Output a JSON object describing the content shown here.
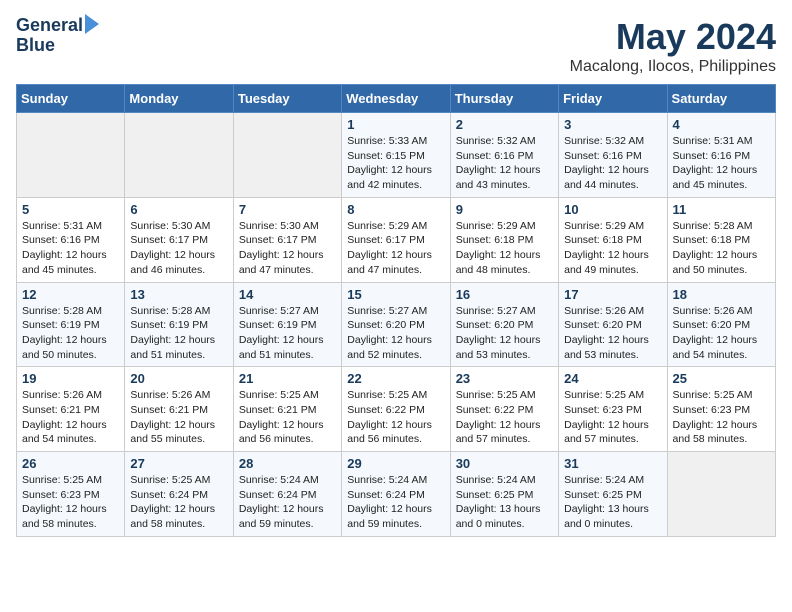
{
  "logo": {
    "line1": "General",
    "line2": "Blue"
  },
  "title": "May 2024",
  "location": "Macalong, Ilocos, Philippines",
  "weekdays": [
    "Sunday",
    "Monday",
    "Tuesday",
    "Wednesday",
    "Thursday",
    "Friday",
    "Saturday"
  ],
  "weeks": [
    [
      {
        "day": "",
        "sunrise": "",
        "sunset": "",
        "daylight": ""
      },
      {
        "day": "",
        "sunrise": "",
        "sunset": "",
        "daylight": ""
      },
      {
        "day": "",
        "sunrise": "",
        "sunset": "",
        "daylight": ""
      },
      {
        "day": "1",
        "sunrise": "Sunrise: 5:33 AM",
        "sunset": "Sunset: 6:15 PM",
        "daylight": "Daylight: 12 hours and 42 minutes."
      },
      {
        "day": "2",
        "sunrise": "Sunrise: 5:32 AM",
        "sunset": "Sunset: 6:16 PM",
        "daylight": "Daylight: 12 hours and 43 minutes."
      },
      {
        "day": "3",
        "sunrise": "Sunrise: 5:32 AM",
        "sunset": "Sunset: 6:16 PM",
        "daylight": "Daylight: 12 hours and 44 minutes."
      },
      {
        "day": "4",
        "sunrise": "Sunrise: 5:31 AM",
        "sunset": "Sunset: 6:16 PM",
        "daylight": "Daylight: 12 hours and 45 minutes."
      }
    ],
    [
      {
        "day": "5",
        "sunrise": "Sunrise: 5:31 AM",
        "sunset": "Sunset: 6:16 PM",
        "daylight": "Daylight: 12 hours and 45 minutes."
      },
      {
        "day": "6",
        "sunrise": "Sunrise: 5:30 AM",
        "sunset": "Sunset: 6:17 PM",
        "daylight": "Daylight: 12 hours and 46 minutes."
      },
      {
        "day": "7",
        "sunrise": "Sunrise: 5:30 AM",
        "sunset": "Sunset: 6:17 PM",
        "daylight": "Daylight: 12 hours and 47 minutes."
      },
      {
        "day": "8",
        "sunrise": "Sunrise: 5:29 AM",
        "sunset": "Sunset: 6:17 PM",
        "daylight": "Daylight: 12 hours and 47 minutes."
      },
      {
        "day": "9",
        "sunrise": "Sunrise: 5:29 AM",
        "sunset": "Sunset: 6:18 PM",
        "daylight": "Daylight: 12 hours and 48 minutes."
      },
      {
        "day": "10",
        "sunrise": "Sunrise: 5:29 AM",
        "sunset": "Sunset: 6:18 PM",
        "daylight": "Daylight: 12 hours and 49 minutes."
      },
      {
        "day": "11",
        "sunrise": "Sunrise: 5:28 AM",
        "sunset": "Sunset: 6:18 PM",
        "daylight": "Daylight: 12 hours and 50 minutes."
      }
    ],
    [
      {
        "day": "12",
        "sunrise": "Sunrise: 5:28 AM",
        "sunset": "Sunset: 6:19 PM",
        "daylight": "Daylight: 12 hours and 50 minutes."
      },
      {
        "day": "13",
        "sunrise": "Sunrise: 5:28 AM",
        "sunset": "Sunset: 6:19 PM",
        "daylight": "Daylight: 12 hours and 51 minutes."
      },
      {
        "day": "14",
        "sunrise": "Sunrise: 5:27 AM",
        "sunset": "Sunset: 6:19 PM",
        "daylight": "Daylight: 12 hours and 51 minutes."
      },
      {
        "day": "15",
        "sunrise": "Sunrise: 5:27 AM",
        "sunset": "Sunset: 6:20 PM",
        "daylight": "Daylight: 12 hours and 52 minutes."
      },
      {
        "day": "16",
        "sunrise": "Sunrise: 5:27 AM",
        "sunset": "Sunset: 6:20 PM",
        "daylight": "Daylight: 12 hours and 53 minutes."
      },
      {
        "day": "17",
        "sunrise": "Sunrise: 5:26 AM",
        "sunset": "Sunset: 6:20 PM",
        "daylight": "Daylight: 12 hours and 53 minutes."
      },
      {
        "day": "18",
        "sunrise": "Sunrise: 5:26 AM",
        "sunset": "Sunset: 6:20 PM",
        "daylight": "Daylight: 12 hours and 54 minutes."
      }
    ],
    [
      {
        "day": "19",
        "sunrise": "Sunrise: 5:26 AM",
        "sunset": "Sunset: 6:21 PM",
        "daylight": "Daylight: 12 hours and 54 minutes."
      },
      {
        "day": "20",
        "sunrise": "Sunrise: 5:26 AM",
        "sunset": "Sunset: 6:21 PM",
        "daylight": "Daylight: 12 hours and 55 minutes."
      },
      {
        "day": "21",
        "sunrise": "Sunrise: 5:25 AM",
        "sunset": "Sunset: 6:21 PM",
        "daylight": "Daylight: 12 hours and 56 minutes."
      },
      {
        "day": "22",
        "sunrise": "Sunrise: 5:25 AM",
        "sunset": "Sunset: 6:22 PM",
        "daylight": "Daylight: 12 hours and 56 minutes."
      },
      {
        "day": "23",
        "sunrise": "Sunrise: 5:25 AM",
        "sunset": "Sunset: 6:22 PM",
        "daylight": "Daylight: 12 hours and 57 minutes."
      },
      {
        "day": "24",
        "sunrise": "Sunrise: 5:25 AM",
        "sunset": "Sunset: 6:23 PM",
        "daylight": "Daylight: 12 hours and 57 minutes."
      },
      {
        "day": "25",
        "sunrise": "Sunrise: 5:25 AM",
        "sunset": "Sunset: 6:23 PM",
        "daylight": "Daylight: 12 hours and 58 minutes."
      }
    ],
    [
      {
        "day": "26",
        "sunrise": "Sunrise: 5:25 AM",
        "sunset": "Sunset: 6:23 PM",
        "daylight": "Daylight: 12 hours and 58 minutes."
      },
      {
        "day": "27",
        "sunrise": "Sunrise: 5:25 AM",
        "sunset": "Sunset: 6:24 PM",
        "daylight": "Daylight: 12 hours and 58 minutes."
      },
      {
        "day": "28",
        "sunrise": "Sunrise: 5:24 AM",
        "sunset": "Sunset: 6:24 PM",
        "daylight": "Daylight: 12 hours and 59 minutes."
      },
      {
        "day": "29",
        "sunrise": "Sunrise: 5:24 AM",
        "sunset": "Sunset: 6:24 PM",
        "daylight": "Daylight: 12 hours and 59 minutes."
      },
      {
        "day": "30",
        "sunrise": "Sunrise: 5:24 AM",
        "sunset": "Sunset: 6:25 PM",
        "daylight": "Daylight: 13 hours and 0 minutes."
      },
      {
        "day": "31",
        "sunrise": "Sunrise: 5:24 AM",
        "sunset": "Sunset: 6:25 PM",
        "daylight": "Daylight: 13 hours and 0 minutes."
      },
      {
        "day": "",
        "sunrise": "",
        "sunset": "",
        "daylight": ""
      }
    ]
  ]
}
